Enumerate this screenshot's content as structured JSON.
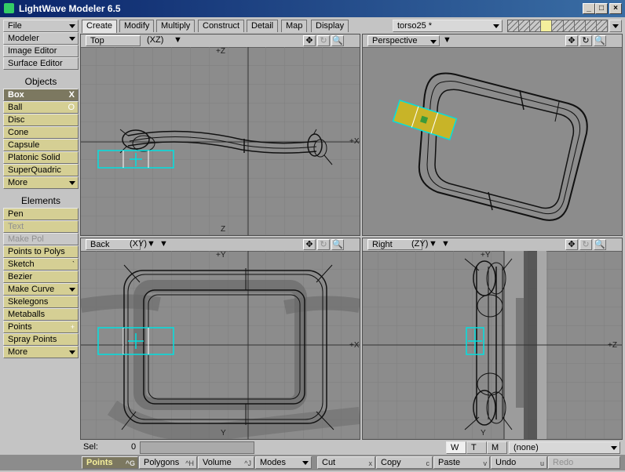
{
  "window": {
    "title": "LightWave Modeler 6.5",
    "min": "_",
    "max": "□",
    "close": "×"
  },
  "sidebar": {
    "menus": [
      {
        "label": "File"
      },
      {
        "label": "Modeler"
      },
      {
        "label": "Image Editor"
      },
      {
        "label": "Surface Editor"
      }
    ],
    "objects_header": "Objects",
    "objects": [
      {
        "label": "Box",
        "key": "X"
      },
      {
        "label": "Ball",
        "key": "O"
      },
      {
        "label": "Disc"
      },
      {
        "label": "Cone"
      },
      {
        "label": "Capsule"
      },
      {
        "label": "Platonic Solid"
      },
      {
        "label": "SuperQuadric"
      },
      {
        "label": "More"
      }
    ],
    "elements_header": "Elements",
    "elements": [
      {
        "label": "Pen"
      },
      {
        "label": "Text"
      },
      {
        "label": "Make Pol"
      },
      {
        "label": "Points to Polys"
      },
      {
        "label": "Sketch",
        "key": "`"
      },
      {
        "label": "Bezier"
      },
      {
        "label": "Make Curve"
      },
      {
        "label": "Skelegons"
      },
      {
        "label": "Metaballs"
      },
      {
        "label": "Points",
        "key": "+"
      },
      {
        "label": "Spray Points"
      },
      {
        "label": "More"
      }
    ]
  },
  "tabs": [
    "Create",
    "Modify",
    "Multiply",
    "Construct",
    "Detail",
    "Map",
    "Display"
  ],
  "object_select": {
    "value": "torso25 *"
  },
  "viewports": {
    "top": {
      "name": "Top",
      "mode": "(XZ)",
      "axis_h": "+X",
      "axis_v_top": "+Z",
      "axis_v_bot": "Z"
    },
    "perspective": {
      "name": "Perspective"
    },
    "back": {
      "name": "Back",
      "mode": "(XY)",
      "axis_h": "+X",
      "axis_v_top": "+Y",
      "axis_v_bot": "Y"
    },
    "right": {
      "name": "Right",
      "mode": "(ZY)",
      "axis_h": "+Z",
      "axis_v_top": "+Y",
      "axis_v_bot": "Y"
    }
  },
  "viewport_icons": {
    "move": "✥",
    "rotate": "↻",
    "zoom": "🔍"
  },
  "status": {
    "sel_label": "Sel:",
    "sel_value": "0",
    "wtm": [
      "W",
      "T",
      "M"
    ],
    "surface": "(none)"
  },
  "bottom_bar": [
    {
      "label": "Points",
      "key": "^G"
    },
    {
      "label": "Polygons",
      "key": "^H"
    },
    {
      "label": "Volume",
      "key": "^J"
    },
    {
      "label": "Modes"
    },
    {
      "label": "Cut",
      "key": "x"
    },
    {
      "label": "Copy",
      "key": "c"
    },
    {
      "label": "Paste",
      "key": "v"
    },
    {
      "label": "Undo",
      "key": "u"
    },
    {
      "label": "Redo"
    }
  ],
  "colors": {
    "selection": "#00e0e0",
    "active_layer": "#f4ef9c",
    "ui_bg": "#c4c4c4",
    "viewport_bg": "#8c8c8c"
  }
}
